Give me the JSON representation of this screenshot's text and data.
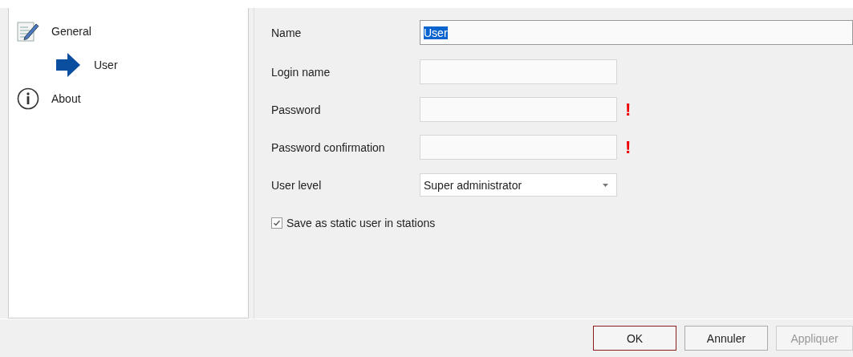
{
  "sidebar": {
    "items": [
      {
        "label": "General",
        "children": [
          {
            "label": "User"
          }
        ]
      },
      {
        "label": "About"
      }
    ]
  },
  "form": {
    "fields": [
      {
        "label": "Name",
        "kind": "wide-text",
        "value": "User"
      },
      {
        "label": "Login name",
        "kind": "text"
      },
      {
        "label": "Password",
        "kind": "text",
        "error_mark": "!"
      },
      {
        "label": "Password confirmation",
        "kind": "text",
        "error_mark": "!"
      },
      {
        "label": "User level",
        "kind": "dropdown",
        "value": "Super administrator"
      }
    ],
    "checkbox": {
      "label": "Save as static user in stations",
      "checked": true
    }
  },
  "buttons": [
    {
      "label": "OK",
      "default": true,
      "disabled": false
    },
    {
      "label": "Annuler",
      "default": false,
      "disabled": false
    },
    {
      "label": "Appliquer",
      "default": false,
      "disabled": true
    }
  ]
}
